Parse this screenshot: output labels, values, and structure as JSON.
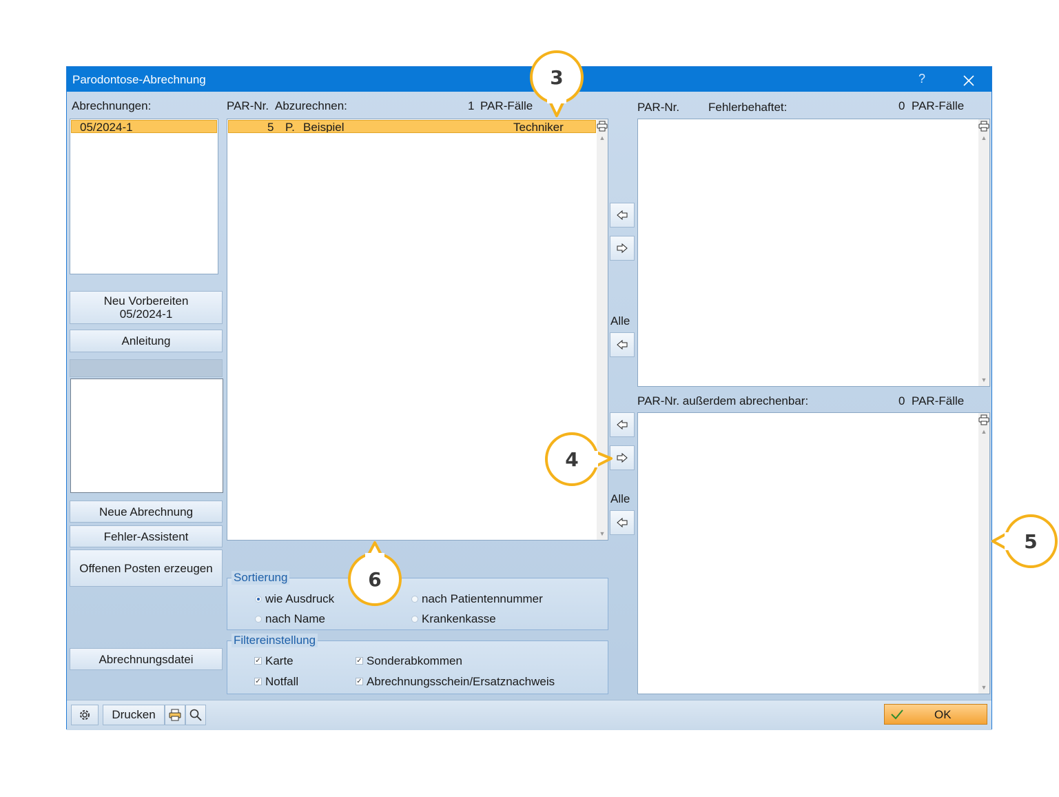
{
  "window": {
    "title": "Parodontose-Abrechnung",
    "help": "?",
    "close": "✕"
  },
  "left": {
    "label": "Abrechnungen:",
    "items": [
      "05/2024-1"
    ],
    "buttons": {
      "neu_vorbereiten_line1": "Neu Vorbereiten",
      "neu_vorbereiten_line2": "05/2024-1",
      "anleitung": "Anleitung",
      "neue_abrechnung": "Neue Abrechnung",
      "fehler_assistent": "Fehler-Assistent",
      "offene_posten": "Offenen Posten erzeugen",
      "abrechnungsdatei": "Abrechnungsdatei"
    }
  },
  "middle": {
    "header_par": "PAR-Nr.",
    "header_label": "Abzurechnen:",
    "count": "1",
    "count_unit": "PAR-Fälle",
    "rows": [
      {
        "nr": "5",
        "initial": "P.",
        "name": "Beispiel",
        "kasse": "Techniker Krank"
      }
    ]
  },
  "transfer": {
    "alle1": "Alle",
    "alle2": "Alle"
  },
  "right_top": {
    "header_par": "PAR-Nr.",
    "header_label": "Fehlerbehaftet:",
    "count": "0",
    "count_unit": "PAR-Fälle"
  },
  "right_bottom": {
    "header_label": "PAR-Nr. außerdem abrechenbar:",
    "count": "0",
    "count_unit": "PAR-Fälle"
  },
  "sortierung": {
    "title": "Sortierung",
    "options": [
      "wie Ausdruck",
      "nach Patientennummer",
      "nach Name",
      "Krankenkasse"
    ],
    "selected": "wie Ausdruck"
  },
  "filter": {
    "title": "Filtereinstellung",
    "options": [
      "Karte",
      "Sonderabkommen",
      "Notfall",
      "Abrechnungsschein/Ersatznachweis"
    ],
    "checked": true
  },
  "statusbar": {
    "drucken": "Drucken",
    "ok": "OK"
  },
  "callouts": [
    "3",
    "4",
    "5",
    "6"
  ],
  "colors": {
    "accent": "#0a79d8",
    "selection": "#fcc65a",
    "callout": "#f5b21b"
  }
}
